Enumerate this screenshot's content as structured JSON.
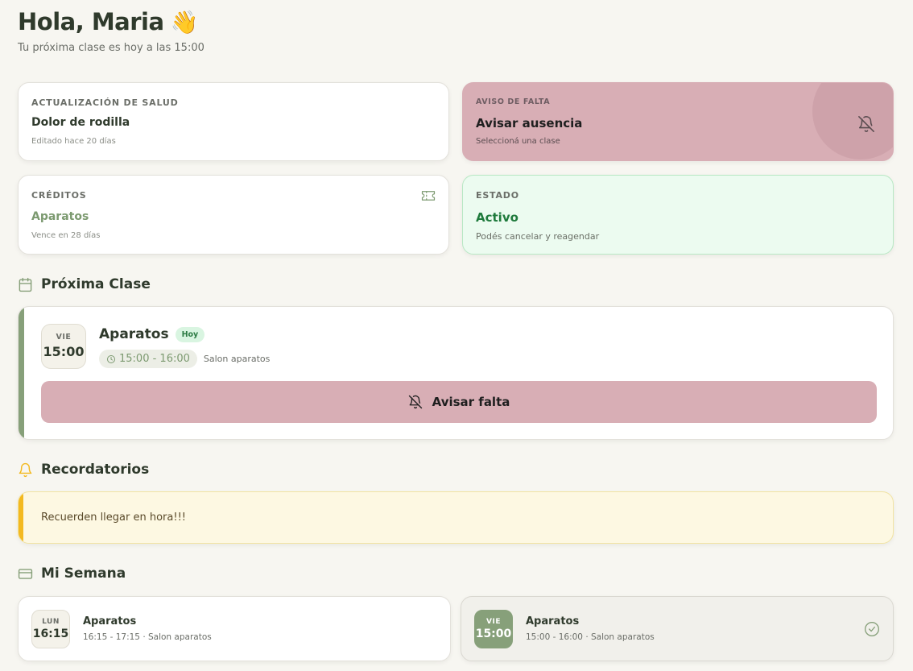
{
  "greeting": {
    "title": "Hola, Maria",
    "emoji": "👋",
    "subtitle": "Tu próxima clase es hoy a las 15:00"
  },
  "cards": {
    "health": {
      "label": "ACTUALIZACIÓN DE SALUD",
      "value": "Dolor de rodilla",
      "note": "Editado hace 20 días"
    },
    "absence": {
      "label": "AVISO DE FALTA",
      "value": "Avisar ausencia",
      "note": "Seleccioná una clase",
      "icon": "bell-off-icon"
    },
    "credits": {
      "label": "CRÉDITOS",
      "value": "Aparatos",
      "note": "Vence en 28 días",
      "icon": "ticket-icon"
    },
    "status": {
      "label": "ESTADO",
      "value": "Activo",
      "note": "Podés cancelar y reagendar"
    }
  },
  "next_class": {
    "heading": "Próxima Clase",
    "day": "VIE",
    "time": "15:00",
    "title": "Aparatos",
    "badge": "Hoy",
    "time_range": "15:00 - 16:00",
    "room": "Salon aparatos",
    "button_label": "Avisar falta"
  },
  "reminders": {
    "heading": "Recordatorios",
    "message": "Recuerden llegar en hora!!!"
  },
  "week": {
    "heading": "Mi Semana",
    "items": [
      {
        "day": "LUN",
        "time": "16:15",
        "title": "Aparatos",
        "detail": "16:15 - 17:15 · Salon aparatos"
      },
      {
        "day": "VIE",
        "time": "15:00",
        "title": "Aparatos",
        "detail": "15:00 - 16:00 · Salon aparatos"
      }
    ]
  },
  "colors": {
    "background": "#f7f6f1",
    "accent_green": "#87a07a",
    "absence_pink": "#d8aeb5",
    "status_green": "#1f7a3c",
    "reminder_yellow": "#f3b920"
  }
}
